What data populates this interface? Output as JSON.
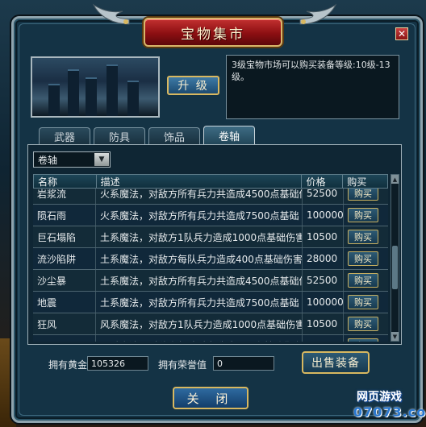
{
  "window": {
    "title": "宝物集市",
    "close_glyph": "✕"
  },
  "info": {
    "upgrade_label": "升 级",
    "description": "3级宝物市场可以购买装备等级:10级-13级。"
  },
  "tabs": [
    {
      "label": "武器",
      "active": false
    },
    {
      "label": "防具",
      "active": false
    },
    {
      "label": "饰品",
      "active": false
    },
    {
      "label": "卷轴",
      "active": true
    }
  ],
  "filter": {
    "selected": "卷轴"
  },
  "table": {
    "headers": {
      "name": "名称",
      "desc": "描述",
      "price": "价格",
      "buy": "购买"
    },
    "rows": [
      {
        "name": "岩浆流",
        "desc": "火系魔法，对敌方所有兵力共造成4500点基础伤",
        "price": "52500",
        "buy": "购买"
      },
      {
        "name": "陨石雨",
        "desc": "火系魔法，对敌方所有兵力共造成7500点基础",
        "price": "100000",
        "buy": "购买"
      },
      {
        "name": "巨石塌陷",
        "desc": "土系魔法，对敌方1队兵力造成1000点基础伤害",
        "price": "10500",
        "buy": "购买"
      },
      {
        "name": "流沙陷阱",
        "desc": "土系魔法，对敌方每队兵力造成400点基础伤害",
        "price": "28000",
        "buy": "购买"
      },
      {
        "name": "沙尘暴",
        "desc": "土系魔法，对敌方所有兵力共造成4500点基础伤",
        "price": "52500",
        "buy": "购买"
      },
      {
        "name": "地震",
        "desc": "土系魔法，对敌方所有兵力共造成7500点基础",
        "price": "100000",
        "buy": "购买"
      },
      {
        "name": "狂风",
        "desc": "风系魔法，对敌方1队兵力造成1000点基础伤害",
        "price": "10500",
        "buy": "购买"
      },
      {
        "name": "飓风",
        "desc": "风系魔法，对敌方每队兵力造成400点基础伤害",
        "price": "28000",
        "buy": "购买"
      }
    ]
  },
  "stats": {
    "gold_label": "拥有黄金",
    "gold_value": "105326",
    "honor_label": "拥有荣誉值",
    "honor_value": "0"
  },
  "buttons": {
    "sell_label": "出售装备",
    "close_label": "关 闭"
  },
  "watermark": {
    "line1": "网页游戏",
    "line2": "07073.com"
  },
  "colors": {
    "panel": "#143345",
    "title_red": "#8c0f12",
    "gold_border": "#d8b860"
  }
}
